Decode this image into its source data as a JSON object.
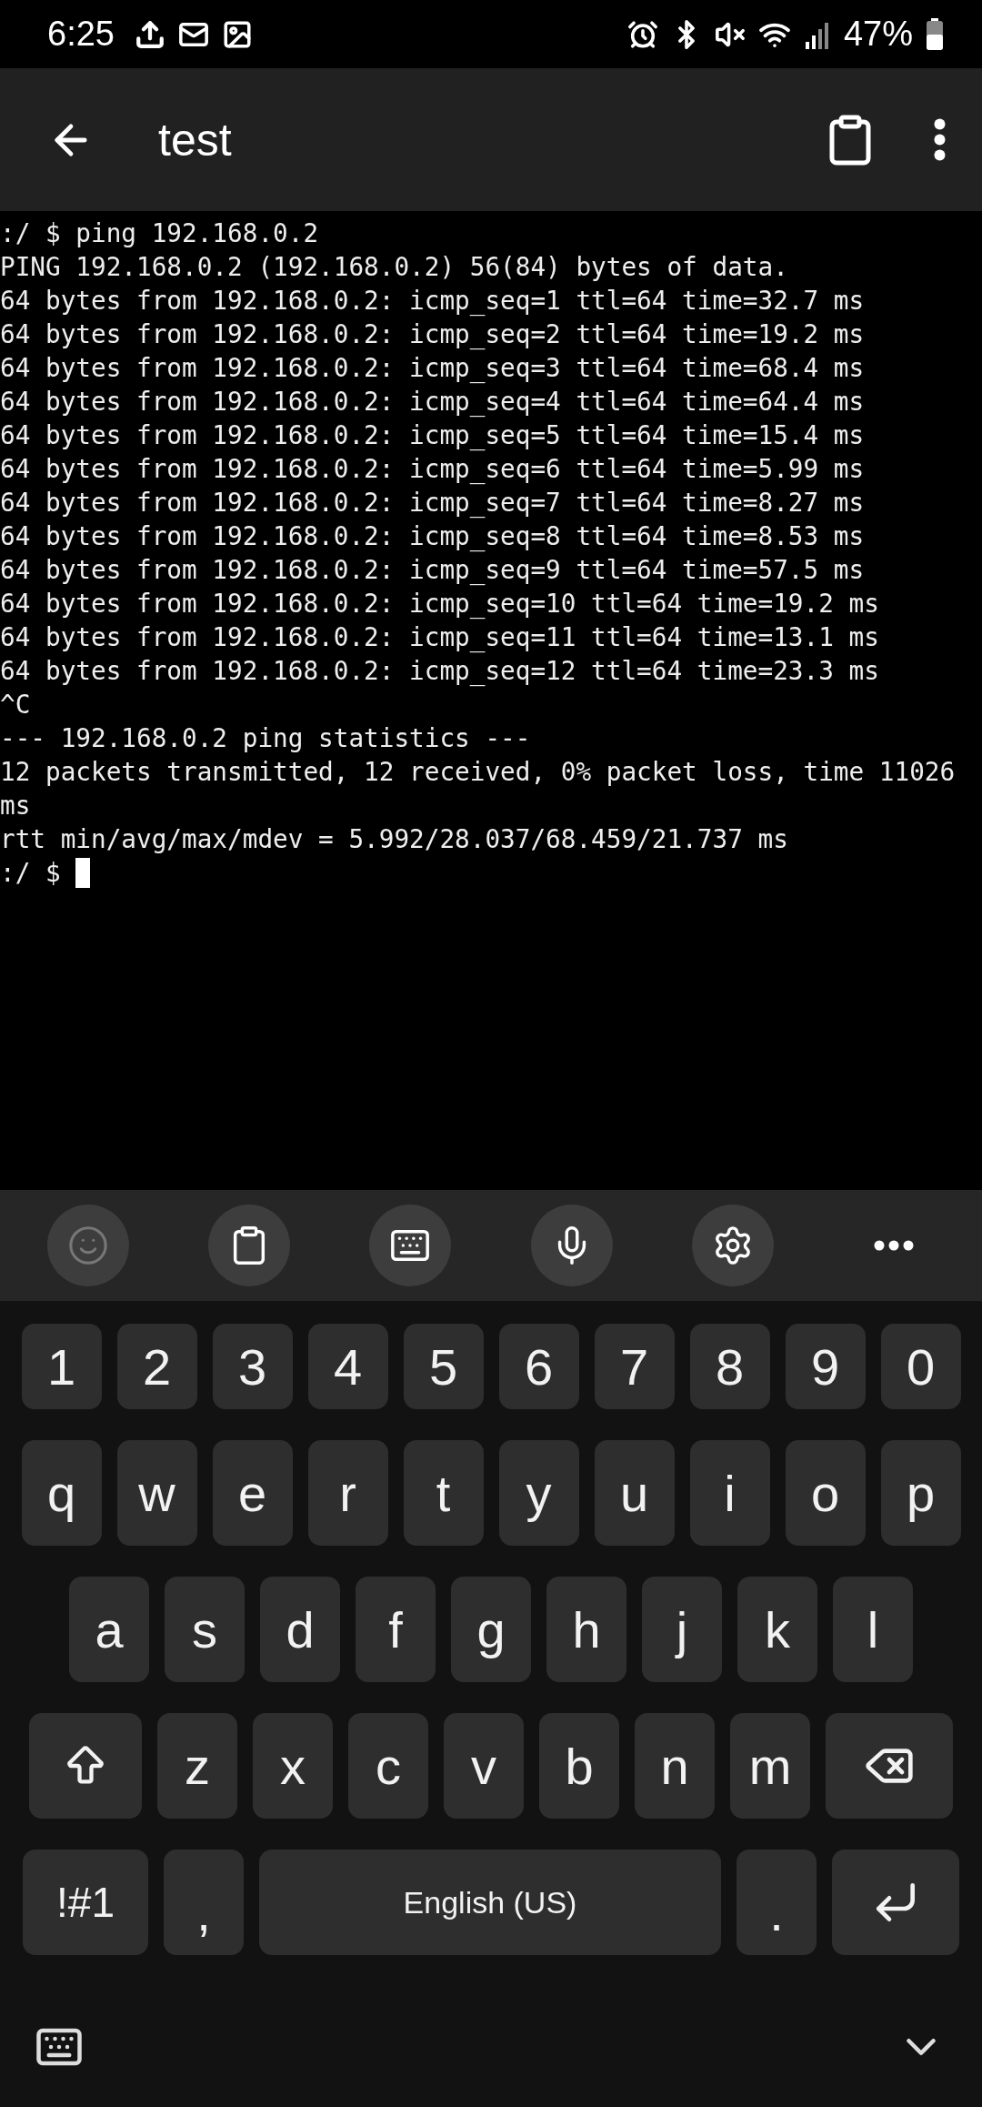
{
  "status_bar": {
    "time": "6:25",
    "battery": "47%"
  },
  "app_bar": {
    "title": "test"
  },
  "terminal": {
    "lines": [
      ":/ $ ping 192.168.0.2",
      "PING 192.168.0.2 (192.168.0.2) 56(84) bytes of data.",
      "64 bytes from 192.168.0.2: icmp_seq=1 ttl=64 time=32.7 ms",
      "64 bytes from 192.168.0.2: icmp_seq=2 ttl=64 time=19.2 ms",
      "64 bytes from 192.168.0.2: icmp_seq=3 ttl=64 time=68.4 ms",
      "64 bytes from 192.168.0.2: icmp_seq=4 ttl=64 time=64.4 ms",
      "64 bytes from 192.168.0.2: icmp_seq=5 ttl=64 time=15.4 ms",
      "64 bytes from 192.168.0.2: icmp_seq=6 ttl=64 time=5.99 ms",
      "64 bytes from 192.168.0.2: icmp_seq=7 ttl=64 time=8.27 ms",
      "64 bytes from 192.168.0.2: icmp_seq=8 ttl=64 time=8.53 ms",
      "64 bytes from 192.168.0.2: icmp_seq=9 ttl=64 time=57.5 ms",
      "64 bytes from 192.168.0.2: icmp_seq=10 ttl=64 time=19.2 ms",
      "64 bytes from 192.168.0.2: icmp_seq=11 ttl=64 time=13.1 ms",
      "64 bytes from 192.168.0.2: icmp_seq=12 ttl=64 time=23.3 ms",
      "^C",
      "--- 192.168.0.2 ping statistics ---",
      "12 packets transmitted, 12 received, 0% packet loss, time 11026",
      "ms",
      "rtt min/avg/max/mdev = 5.992/28.037/68.459/21.737 ms"
    ],
    "prompt": ":/ $"
  },
  "keyboard": {
    "toolbar": [
      {
        "kind": "emoji",
        "disabled": true
      },
      {
        "kind": "clipboard",
        "disabled": false
      },
      {
        "kind": "keypad",
        "disabled": false
      },
      {
        "kind": "voice",
        "disabled": false
      },
      {
        "kind": "settings",
        "disabled": false
      },
      {
        "kind": "more",
        "disabled": false
      }
    ],
    "rows": [
      [
        {
          "kind": "char",
          "label": "1"
        },
        {
          "kind": "char",
          "label": "2"
        },
        {
          "kind": "char",
          "label": "3"
        },
        {
          "kind": "char",
          "label": "4"
        },
        {
          "kind": "char",
          "label": "5"
        },
        {
          "kind": "char",
          "label": "6"
        },
        {
          "kind": "char",
          "label": "7"
        },
        {
          "kind": "char",
          "label": "8"
        },
        {
          "kind": "char",
          "label": "9"
        },
        {
          "kind": "char",
          "label": "0"
        }
      ],
      [
        {
          "kind": "char",
          "label": "q"
        },
        {
          "kind": "char",
          "label": "w"
        },
        {
          "kind": "char",
          "label": "e"
        },
        {
          "kind": "char",
          "label": "r"
        },
        {
          "kind": "char",
          "label": "t"
        },
        {
          "kind": "char",
          "label": "y"
        },
        {
          "kind": "char",
          "label": "u"
        },
        {
          "kind": "char",
          "label": "i"
        },
        {
          "kind": "char",
          "label": "o"
        },
        {
          "kind": "char",
          "label": "p"
        }
      ],
      [
        {
          "kind": "char",
          "label": "a"
        },
        {
          "kind": "char",
          "label": "s"
        },
        {
          "kind": "char",
          "label": "d"
        },
        {
          "kind": "char",
          "label": "f"
        },
        {
          "kind": "char",
          "label": "g"
        },
        {
          "kind": "char",
          "label": "h"
        },
        {
          "kind": "char",
          "label": "j"
        },
        {
          "kind": "char",
          "label": "k"
        },
        {
          "kind": "char",
          "label": "l"
        }
      ],
      [
        {
          "kind": "shift"
        },
        {
          "kind": "char",
          "label": "z"
        },
        {
          "kind": "char",
          "label": "x"
        },
        {
          "kind": "char",
          "label": "c"
        },
        {
          "kind": "char",
          "label": "v"
        },
        {
          "kind": "char",
          "label": "b"
        },
        {
          "kind": "char",
          "label": "n"
        },
        {
          "kind": "char",
          "label": "m"
        },
        {
          "kind": "backspace"
        }
      ]
    ],
    "bottom_row": [
      {
        "kind": "symbols",
        "label": "!#1"
      },
      {
        "kind": "punct",
        "label": ","
      },
      {
        "kind": "space",
        "label": "English (US)"
      },
      {
        "kind": "punct",
        "label": "."
      },
      {
        "kind": "enter"
      }
    ]
  }
}
